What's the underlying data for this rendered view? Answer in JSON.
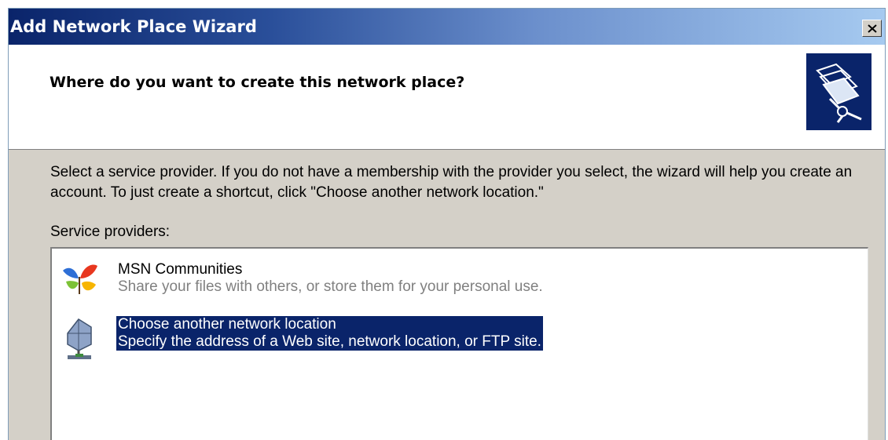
{
  "window": {
    "title": "Add Network Place Wizard",
    "close_label": "×"
  },
  "header": {
    "title": "Where do you want to create this network place?",
    "icon": "network-folder-icon"
  },
  "body": {
    "instructions": "Select a service provider.  If you do not have a membership with the provider you select, the wizard will help you create an account.  To just create a shortcut, click \"Choose another network location.\"",
    "providers_label": "Service providers:"
  },
  "providers": [
    {
      "name": "MSN Communities",
      "description": "Share your files with others, or store them for your personal use.",
      "icon": "msn-butterfly-icon",
      "selected": false
    },
    {
      "name": "Choose another network location",
      "description": "Specify the address of a Web site, network location, or FTP site.",
      "icon": "network-globe-icon",
      "selected": true
    }
  ],
  "colors": {
    "title_gradient_start": "#0a246a",
    "title_gradient_end": "#a6caf0",
    "selection": "#0a246a",
    "dialog_bg": "#d4d0c8"
  }
}
